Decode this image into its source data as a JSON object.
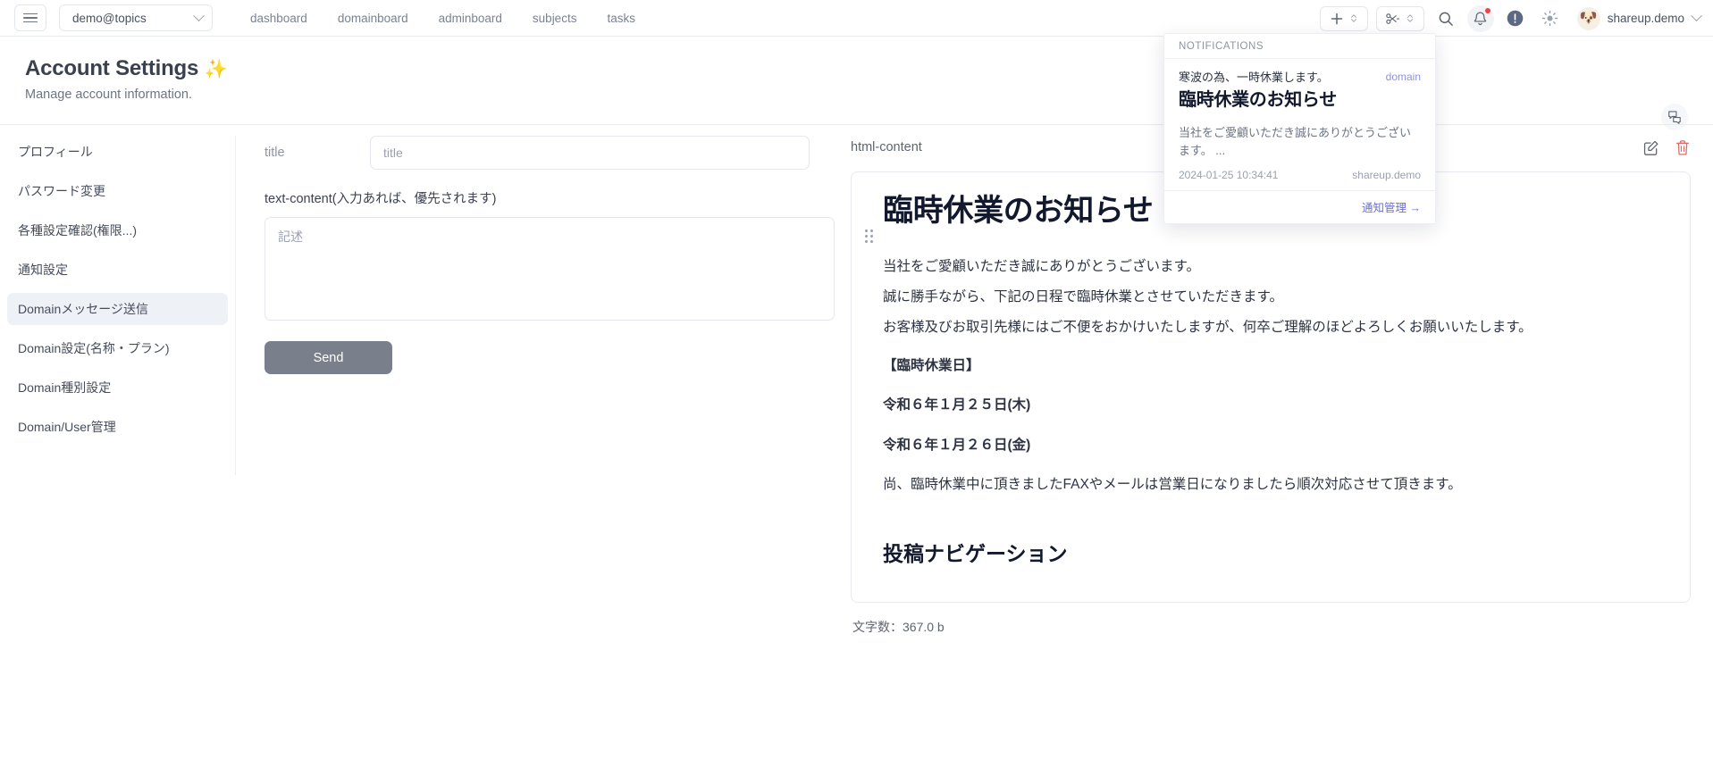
{
  "topbar": {
    "menu_icon": "hamburger-icon",
    "domain_selector": {
      "value": "demo@topics",
      "chevron_icon": "chevron-down-icon"
    },
    "tabs": [
      {
        "label": "dashboard"
      },
      {
        "label": "domainboard"
      },
      {
        "label": "adminboard"
      },
      {
        "label": "subjects"
      },
      {
        "label": "tasks"
      }
    ],
    "add_button": {
      "glyph": "+",
      "icon": "plus-icon",
      "stepper_icon": "up-down-chevrons-icon"
    },
    "cut_button": {
      "glyph": "✂",
      "icon": "scissors-icon",
      "stepper_icon": "up-down-chevrons-icon"
    },
    "search_icon": "search-icon",
    "bell_icon": "bell-icon",
    "bell_has_badge": true,
    "info_icon": "info-circle-icon",
    "theme_icon": "sun-brightness-icon",
    "avatar_icon": "dog-avatar",
    "avatar_glyph": "🐶",
    "user_name": "shareup.demo",
    "user_chevron_icon": "chevron-down-icon"
  },
  "header": {
    "title": "Account Settings",
    "title_sparkle": "✨",
    "subtitle": "Manage account information.",
    "chat_icon": "chat-bubbles-icon"
  },
  "sidebar": {
    "items": [
      {
        "label": "プロフィール",
        "active": false
      },
      {
        "label": "パスワード変更",
        "active": false
      },
      {
        "label": "各種設定確認(権限...)",
        "active": false
      },
      {
        "label": "通知設定",
        "active": false
      },
      {
        "label": "Domainメッセージ送信",
        "active": true
      },
      {
        "label": "Domain設定(名称・プラン)",
        "active": false
      },
      {
        "label": "Domain種別設定",
        "active": false
      },
      {
        "label": "Domain/User管理",
        "active": false
      }
    ]
  },
  "form": {
    "title_label": "title",
    "title_placeholder": "title",
    "title_value": "",
    "text_content_label": "text-content(入力あれば、優先されます)",
    "text_content_placeholder": "記述",
    "text_content_value": "",
    "send_label": "Send"
  },
  "preview": {
    "panel_label": "html-content",
    "edit_icon": "edit-pencil-square-icon",
    "delete_icon": "trash-delete-icon",
    "drag_handle_icon": "drag-handle-dots-icon",
    "heading": "臨時休業のお知らせ",
    "paragraphs": [
      "当社をご愛顧いただき誠にありがとうございます。",
      "誠に勝手ながら、下記の日程で臨時休業とさせていただきます。",
      "お客様及びお取引先様にはご不便をおかけいたしますが、何卒ご理解のほどよろしくお願いいたします。"
    ],
    "closure_label": "【臨時休業日】",
    "closure_dates": [
      "令和６年１月２５日(木)",
      "令和６年１月２６日(金)"
    ],
    "footnote": "尚、臨時休業中に頂きましたFAXやメールは営業日になりましたら順次対応させて頂きます。",
    "nav_heading": "投稿ナビゲーション",
    "char_count": "文字数：367.0 b"
  },
  "notifications": {
    "header": "NOTIFICATIONS",
    "items": [
      {
        "lead": "寒波の為、一時休業します。",
        "tag": "domain",
        "title": "臨時休業のお知らせ",
        "body": "当社をご愛顧いただき誠にありがとうございます。 ...",
        "timestamp": "2024-01-25 10:34:41",
        "source": "shareup.demo"
      }
    ],
    "footer_link": "通知管理 →"
  },
  "colors": {
    "accent_link": "#6a6fd0",
    "tag": "#8f93d6",
    "danger": "#e06a6a",
    "badge": "#ef4444",
    "send_button": "#7a7f8c",
    "active_item": "#eef1f6"
  }
}
